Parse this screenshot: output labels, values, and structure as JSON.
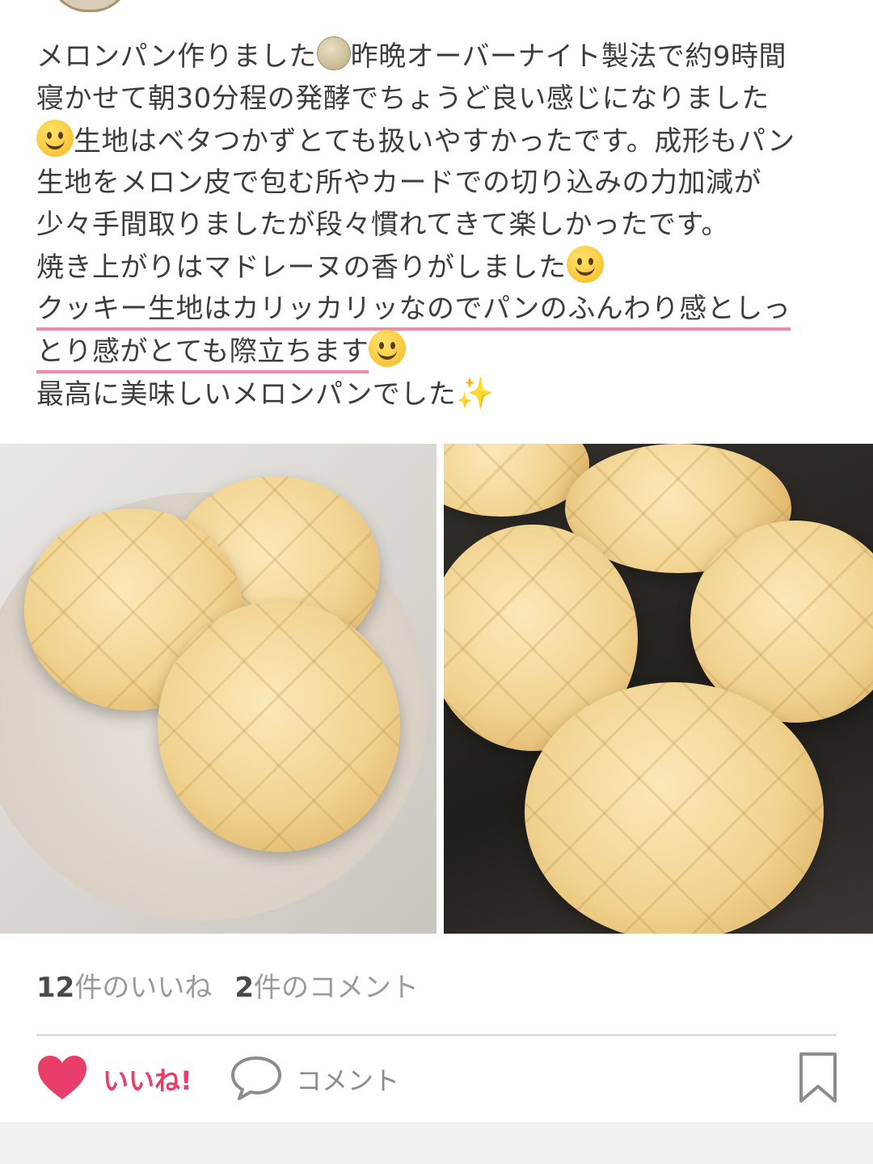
{
  "post": {
    "lines": [
      {
        "text_a": "メロンパン作りました",
        "emoji_a": "melon",
        "text_b": "昨晩オーバーナイト製法で約9時間"
      },
      {
        "text_a": "寝かせて朝30分程の発酵でちょうど良い感じになりました"
      },
      {
        "emoji_a": "smiling-face",
        "text_a": "生地はベタつかずとても扱いやすかったです。成形もパン"
      },
      {
        "text_a": "生地をメロン皮で包む所やカードでの切り込みの力加減が"
      },
      {
        "text_a": "少々手間取りましたが段々慣れてきて楽しかったです。"
      },
      {
        "text_a": "焼き上がりはマドレーヌの香りがしました",
        "emoji_a": "yum-face"
      },
      {
        "text_a": "クッキー生地はカリッカリッなのでパンのふんわり感としっ",
        "highlight": true
      },
      {
        "text_a": "とり感がとても際立ちます",
        "emoji_a": "grinning-face",
        "highlight": true
      },
      {
        "text_a": "最高に美味しいメロンパンでした",
        "emoji_a": "sparkles"
      }
    ],
    "sparkle_glyph": "✨"
  },
  "stats": {
    "likes_count": "12",
    "likes_label": "件のいいね",
    "comments_count": "2",
    "comments_label": "件のコメント"
  },
  "actions": {
    "like_label": "いいね!",
    "comment_label": "コメント"
  },
  "colors": {
    "accent_pink": "#ea3e6a",
    "highlight_underline": "#f08aa6",
    "muted_text": "#9a9a9a"
  }
}
